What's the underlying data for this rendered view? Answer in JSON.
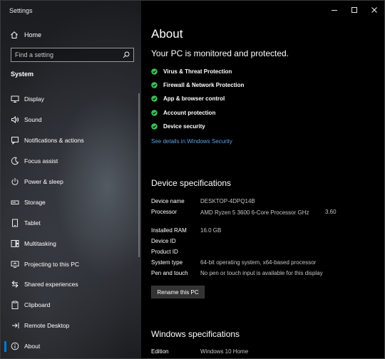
{
  "window": {
    "title": "Settings"
  },
  "sidebar": {
    "home_label": "Home",
    "search_placeholder": "Find a setting",
    "section_title": "System",
    "items": [
      {
        "label": "Display",
        "icon": "display-icon"
      },
      {
        "label": "Sound",
        "icon": "sound-icon"
      },
      {
        "label": "Notifications & actions",
        "icon": "notifications-icon"
      },
      {
        "label": "Focus assist",
        "icon": "focus-assist-icon"
      },
      {
        "label": "Power & sleep",
        "icon": "power-icon"
      },
      {
        "label": "Storage",
        "icon": "storage-icon"
      },
      {
        "label": "Tablet",
        "icon": "tablet-icon"
      },
      {
        "label": "Multitasking",
        "icon": "multitasking-icon"
      },
      {
        "label": "Projecting to this PC",
        "icon": "projecting-icon"
      },
      {
        "label": "Shared experiences",
        "icon": "shared-experiences-icon"
      },
      {
        "label": "Clipboard",
        "icon": "clipboard-icon"
      },
      {
        "label": "Remote Desktop",
        "icon": "remote-desktop-icon"
      },
      {
        "label": "About",
        "icon": "about-icon",
        "selected": true
      }
    ]
  },
  "main": {
    "title": "About",
    "protection_heading": "Your PC is monitored and protected.",
    "security_items": [
      "Virus & Threat Protection",
      "Firewall & Network Protection",
      "App & browser control",
      "Account protection",
      "Device security"
    ],
    "security_link": "See details in Windows Security",
    "device_specs": {
      "heading": "Device specifications",
      "rows": [
        {
          "key": "Device name",
          "value": "DESKTOP-4DPQ14B"
        },
        {
          "key": "Processor",
          "value": "AMD Ryzen 5 3600 6-Core Processor GHz",
          "extra": "3.60"
        },
        {
          "key": "Installed RAM",
          "value": "16.0 GB"
        },
        {
          "key": "Device ID",
          "value": ""
        },
        {
          "key": "Product ID",
          "value": ""
        },
        {
          "key": "System type",
          "value": "64-bit operating system, x64-based processor"
        },
        {
          "key": "Pen and touch",
          "value": "No pen or touch input is available for this display"
        }
      ],
      "rename_button": "Rename this PC"
    },
    "windows_specs": {
      "heading": "Windows specifications",
      "rows": [
        {
          "key": "Edition",
          "value": "Windows 10 Home"
        }
      ]
    }
  },
  "colors": {
    "accent": "#0078d7",
    "check_green": "#3fbf5a",
    "link": "#5aa0e8"
  }
}
